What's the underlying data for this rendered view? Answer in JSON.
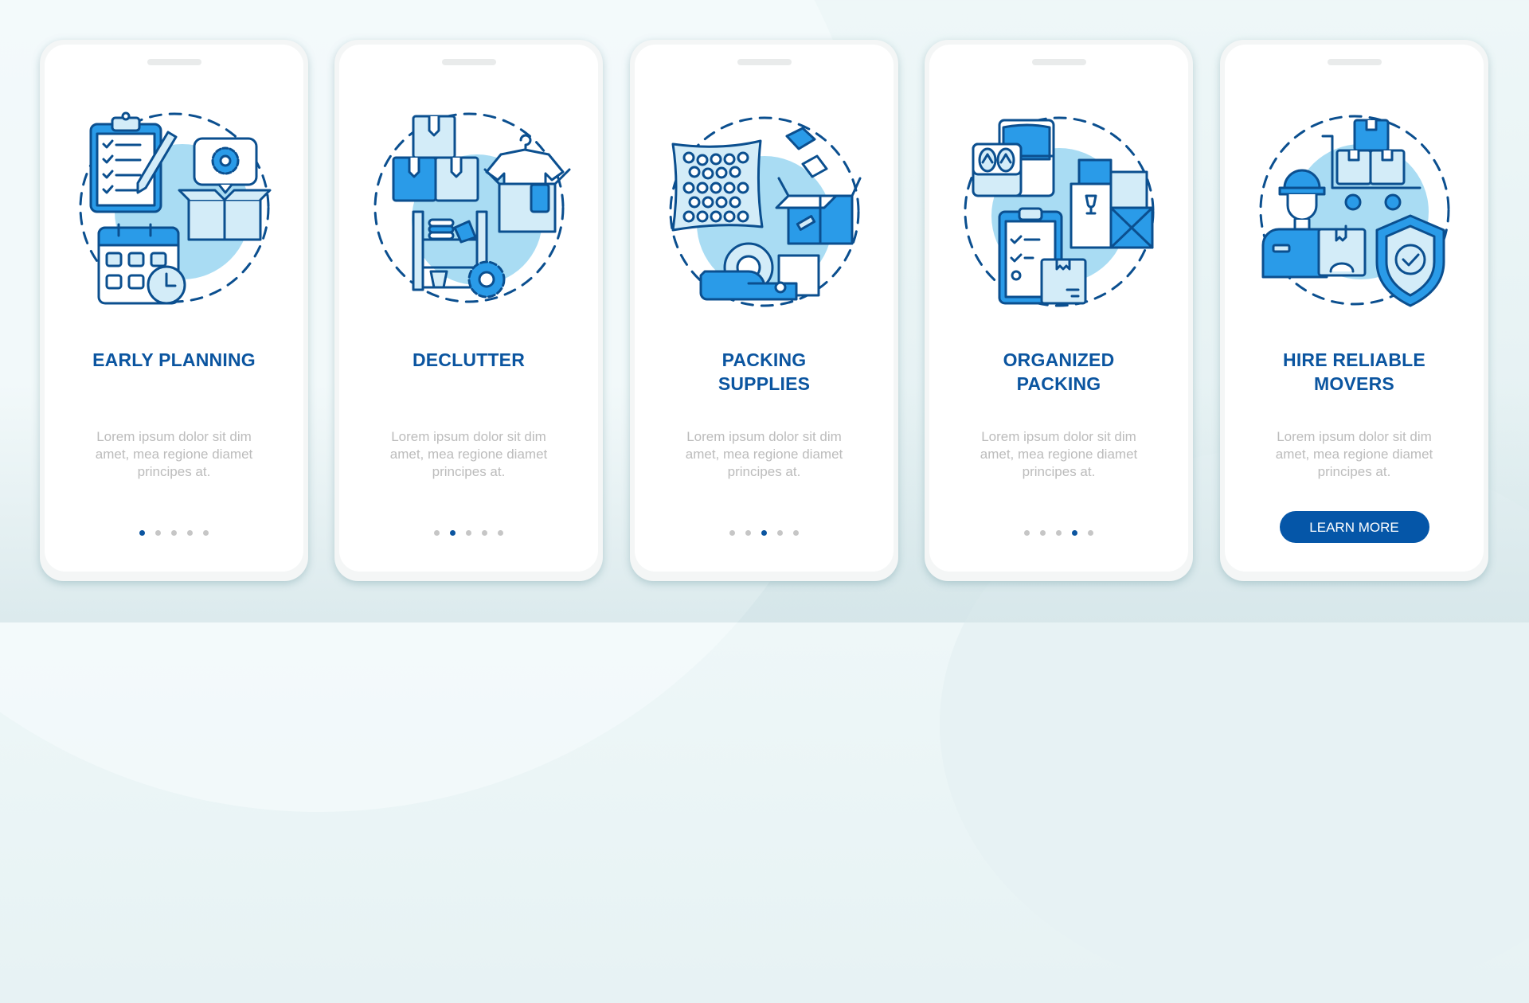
{
  "colors": {
    "accent": "#0b55a0",
    "button": "#0556a8",
    "icon_stroke": "#0b4f8f",
    "icon_fill_strong": "#2a9be8",
    "icon_fill_light": "#d3ecf8",
    "blob": "#a9dcf3",
    "body_text": "#bcbcbc",
    "dot_inactive": "#c6c6c6"
  },
  "cards": [
    {
      "illustration": "early-planning-illustration",
      "icons": [
        "clipboard-checklist-icon",
        "pencil-icon",
        "gear-speech-bubble-icon",
        "open-box-icon",
        "calendar-icon",
        "clock-icon"
      ],
      "title_lines": [
        "EARLY PLANNING"
      ],
      "body_lines": [
        "Lorem ipsum dolor sit dim",
        "amet, mea regione diamet",
        "principes at."
      ],
      "active_dot": 1
    },
    {
      "illustration": "declutter-illustration",
      "icons": [
        "stacked-boxes-icon",
        "shelf-icon",
        "shirt-on-hanger-icon",
        "open-box-icon",
        "gear-icon"
      ],
      "title_lines": [
        "DECLUTTER"
      ],
      "body_lines": [
        "Lorem ipsum dolor sit dim",
        "amet, mea regione diamet",
        "principes at."
      ],
      "active_dot": 2
    },
    {
      "illustration": "packing-supplies-illustration",
      "icons": [
        "bubble-wrap-icon",
        "flying-cubes-icon",
        "open-box-icon",
        "tape-dispenser-icon",
        "box-icon"
      ],
      "title_lines": [
        "PACKING",
        "SUPPLIES"
      ],
      "body_lines": [
        "Lorem ipsum dolor sit dim",
        "amet, mea regione diamet",
        "principes at."
      ],
      "active_dot": 3
    },
    {
      "illustration": "organized-packing-illustration",
      "icons": [
        "flip-flops-bag-icon",
        "shirt-bag-icon",
        "fragile-box-icon",
        "envelope-box-icon",
        "clipboard-checklist-icon",
        "box-icon"
      ],
      "title_lines": [
        "ORGANIZED",
        "PACKING"
      ],
      "body_lines": [
        "Lorem ipsum dolor sit dim",
        "amet, mea regione diamet",
        "principes at."
      ],
      "active_dot": 4
    },
    {
      "illustration": "hire-reliable-movers-illustration",
      "icons": [
        "hand-truck-boxes-icon",
        "mover-person-icon",
        "box-icon",
        "shield-check-icon"
      ],
      "title_lines": [
        "HIRE RELIABLE",
        "MOVERS"
      ],
      "body_lines": [
        "Lorem ipsum dolor sit dim",
        "amet, mea regione diamet",
        "principes at."
      ],
      "active_dot": 5,
      "button_label": "LEARN MORE"
    }
  ],
  "pagination": {
    "total": 5
  }
}
